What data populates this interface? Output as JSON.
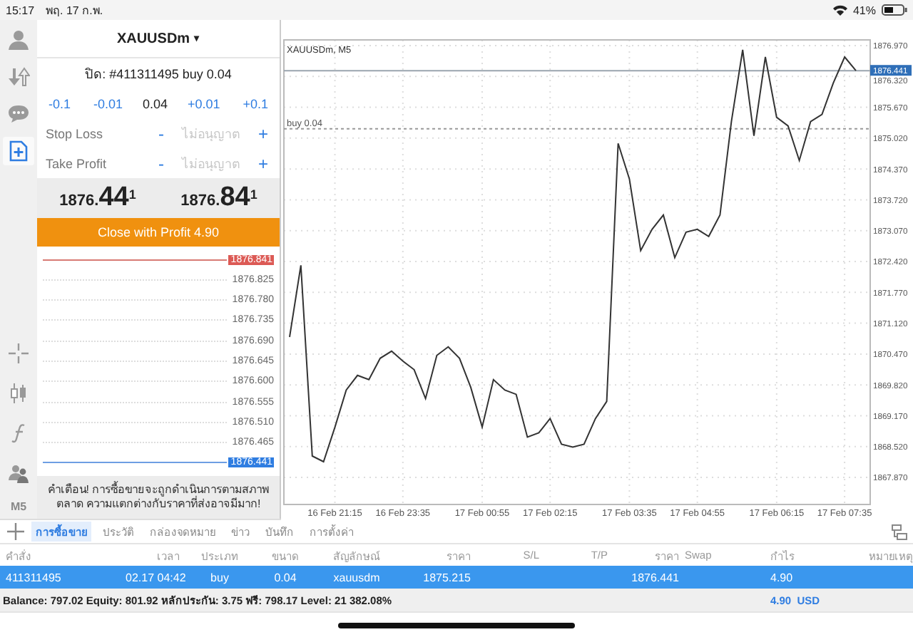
{
  "status_bar": {
    "time": "15:17",
    "date": "พฤ. 17 ก.พ.",
    "battery": "41%"
  },
  "toolbar": [
    {
      "selected": false
    },
    {
      "selected": false
    },
    {
      "selected": false
    },
    {
      "selected": true
    }
  ],
  "timeframe": "M5",
  "order_panel": {
    "symbol": "XAUUSDm",
    "symbol_caret": "▾",
    "position": "ปิด: #411311495 buy 0.04",
    "volume_down": [
      "-0.1",
      "-0.01"
    ],
    "volume": "0.04",
    "volume_up": [
      "+0.01",
      "+0.1"
    ],
    "stops": [
      {
        "label": "Stop Loss",
        "minus": "-",
        "placeholder": "ไม่อนุญาต",
        "plus": "+"
      },
      {
        "label": "Take Profit",
        "minus": "-",
        "placeholder": "ไม่อนุญาต",
        "plus": "+"
      }
    ],
    "bid": "1876.**44**$^{1}$",
    "ask": "1876.**84**$^{1}$",
    "close_button": "Close with Profit 4.90",
    "tick_chart": {
      "ask_label": "1876.841",
      "price_labels": [
        "1876.825",
        "1876.780",
        "1876.735",
        "1876.690",
        "1876.645",
        "1876.600",
        "1876.555",
        "1876.510",
        "1876.465"
      ],
      "bid_label": "1876.441"
    },
    "warning": "คำเตือน! การซื้อขายจะถูกดำเนินการตามสภาพตลาด ความแตกต่างกับราคาที่ส่งอาจมีมาก!"
  },
  "chart": {
    "chart_data": {
      "type": "line",
      "title": "XAUUSDm, M5",
      "grid": true,
      "ylim": [
        1867.3,
        1877.09
      ],
      "categories": [
        null,
        null,
        null,
        null,
        "16 Feb 21:15",
        null,
        null,
        null,
        null,
        null,
        "16 Feb 23:35",
        null,
        null,
        null,
        null,
        null,
        null,
        "17 Feb 00:55",
        null,
        null,
        null,
        null,
        null,
        "17 Feb 02:15",
        null,
        null,
        null,
        null,
        null,
        null,
        "17 Feb 03:35",
        null,
        null,
        null,
        null,
        null,
        "17 Feb 04:55",
        null,
        null,
        null,
        null,
        null,
        null,
        "17 Feb 06:15",
        null,
        null,
        null,
        null,
        null,
        "17 Feb 07:35",
        null
      ],
      "series": [
        {
          "color": "#333333",
          "values": [
            1870.83,
            1872.34,
            1868.32,
            1868.2,
            1868.93,
            1869.71,
            1870.02,
            1869.93,
            1870.38,
            1870.53,
            1870.32,
            1870.14,
            1869.53,
            1870.44,
            1870.62,
            1870.38,
            1869.77,
            1868.93,
            1869.93,
            1869.71,
            1869.62,
            1868.72,
            1868.81,
            1869.11,
            1868.57,
            1868.51,
            1868.57,
            1869.11,
            1869.47,
            1874.91,
            1874.16,
            1872.65,
            1873.1,
            1873.4,
            1872.5,
            1873.04,
            1873.1,
            1872.95,
            1873.4,
            1875.37,
            1876.88,
            1875.07,
            1876.73,
            1875.46,
            1875.28,
            1874.55,
            1875.37,
            1875.52,
            1876.18,
            1876.73,
            1876.44
          ]
        }
      ],
      "yticks": [
        {
          "value": 1876.97,
          "label": "1876.970"
        },
        {
          "value": 1876.32,
          "label": "1876.320"
        },
        {
          "value": 1875.67,
          "label": "1875.670"
        },
        {
          "value": 1875.02,
          "label": "1875.020"
        },
        {
          "value": 1874.37,
          "label": "1874.370"
        },
        {
          "value": 1873.72,
          "label": "1873.720"
        },
        {
          "value": 1873.07,
          "label": "1873.070"
        },
        {
          "value": 1872.42,
          "label": "1872.420"
        },
        {
          "value": 1871.77,
          "label": "1871.770"
        },
        {
          "value": 1871.12,
          "label": "1871.120"
        },
        {
          "value": 1870.47,
          "label": "1870.470"
        },
        {
          "value": 1869.82,
          "label": "1869.820"
        },
        {
          "value": 1869.17,
          "label": "1869.170"
        },
        {
          "value": 1868.52,
          "label": "1868.520"
        },
        {
          "value": 1867.87,
          "label": "1867.870"
        }
      ],
      "ref_lines": [
        {
          "axis": "y",
          "value": 1876.441,
          "label": "1876.441"
        },
        {
          "axis": "y",
          "value": 1875.215,
          "label": "buy 0.04"
        }
      ]
    }
  },
  "tabs": [
    {
      "label": "การซื้อขาย",
      "selected": true
    },
    {
      "label": "ประวัติ",
      "selected": false
    },
    {
      "label": "กล่องจดหมาย",
      "selected": false
    },
    {
      "label": "ข่าว",
      "selected": false
    },
    {
      "label": "บันทึก",
      "selected": false
    },
    {
      "label": "การตั้งค่า",
      "selected": false
    }
  ],
  "table": {
    "columns": [
      "คำสั่ง",
      "เวลา",
      "ประเภท",
      "ขนาด",
      "สัญลักษณ์",
      "ราคา",
      "S/L",
      "T/P",
      "ราคา",
      "Swap",
      "กำไร",
      "หมายเหตุ"
    ],
    "rows": [
      {
        "selected": true,
        "cells": [
          "411311495",
          "02.17 04:42",
          "buy",
          "0.04",
          "xauusdm",
          "1875.215",
          null,
          null,
          "1876.441",
          null,
          "4.90",
          null
        ]
      }
    ]
  },
  "balance": {
    "summary": "Balance: 797.02 Equity: 801.92 หลักประกัน: 3.75 ฟรี: 798.17 Level: 21 382.08%",
    "total": "4.90",
    "currency": "USD"
  }
}
